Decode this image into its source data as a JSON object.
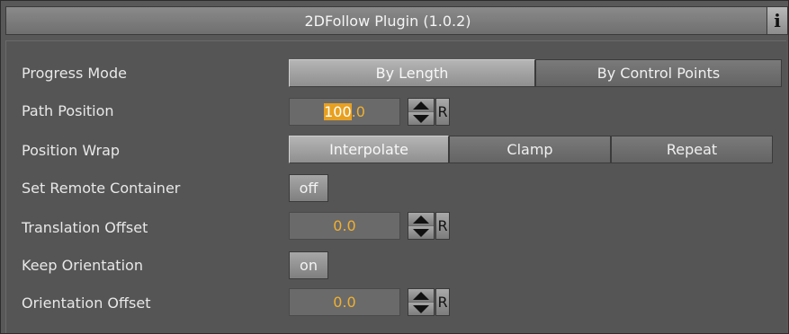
{
  "title": "2DFollow Plugin (1.0.2)",
  "info_icon": "i",
  "rows": {
    "progress_mode": {
      "label": "Progress Mode",
      "options": [
        "By Length",
        "By Control Points"
      ],
      "selected": "By Length"
    },
    "path_position": {
      "label": "Path Position",
      "value_selected": "100",
      "value_rest": ".0",
      "reset": "R"
    },
    "position_wrap": {
      "label": "Position Wrap",
      "options": [
        "Interpolate",
        "Clamp",
        "Repeat"
      ],
      "selected": "Interpolate"
    },
    "set_remote_container": {
      "label": "Set Remote Container",
      "value": "off"
    },
    "translation_offset": {
      "label": "Translation Offset",
      "value": "0.0",
      "reset": "R"
    },
    "keep_orientation": {
      "label": "Keep Orientation",
      "value": "on"
    },
    "orientation_offset": {
      "label": "Orientation Offset",
      "value": "0.0",
      "reset": "R"
    }
  },
  "colors": {
    "panel_bg": "#585858",
    "value_text": "#f0b030",
    "selection": "#e8a020"
  }
}
